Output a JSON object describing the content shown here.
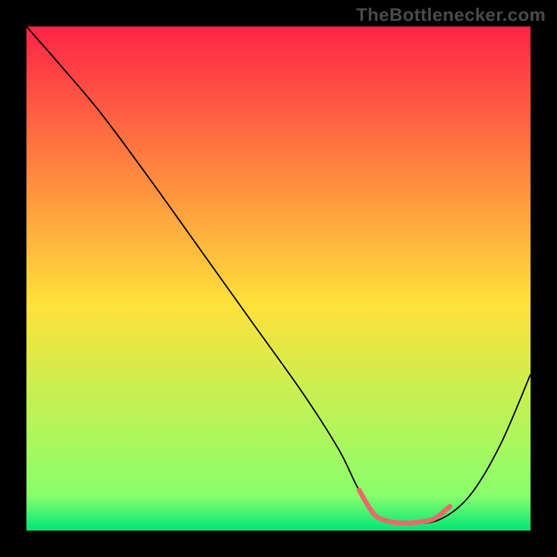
{
  "watermark": "TheBottlenecker.com",
  "chart_data": {
    "type": "line",
    "title": "",
    "xlabel": "",
    "ylabel": "",
    "xlim": [
      0,
      100
    ],
    "ylim": [
      0,
      100
    ],
    "background_gradient": {
      "top": "#ff2346",
      "mid": "#ffe13a",
      "bottom": "#89ff6b",
      "bottom_edge": "#00e676"
    },
    "x": [
      0,
      7,
      15,
      25,
      35,
      45,
      55,
      62,
      66,
      70,
      76,
      82,
      88,
      94,
      100
    ],
    "series": [
      {
        "name": "bottleneck-curve",
        "values": [
          100,
          92,
          82.5,
          69,
          55,
          41,
          27,
          16,
          8,
          2.8,
          1.5,
          2.2,
          7,
          17,
          31
        ],
        "stroke": "#000000",
        "stroke_width": 2
      }
    ],
    "highlight": {
      "name": "sweet-spot",
      "x_range": [
        66,
        84
      ],
      "values": [
        8,
        3.2,
        1.8,
        1.5,
        1.7,
        2.4,
        4.8
      ],
      "stroke": "#e86a6a",
      "stroke_width": 7
    }
  }
}
